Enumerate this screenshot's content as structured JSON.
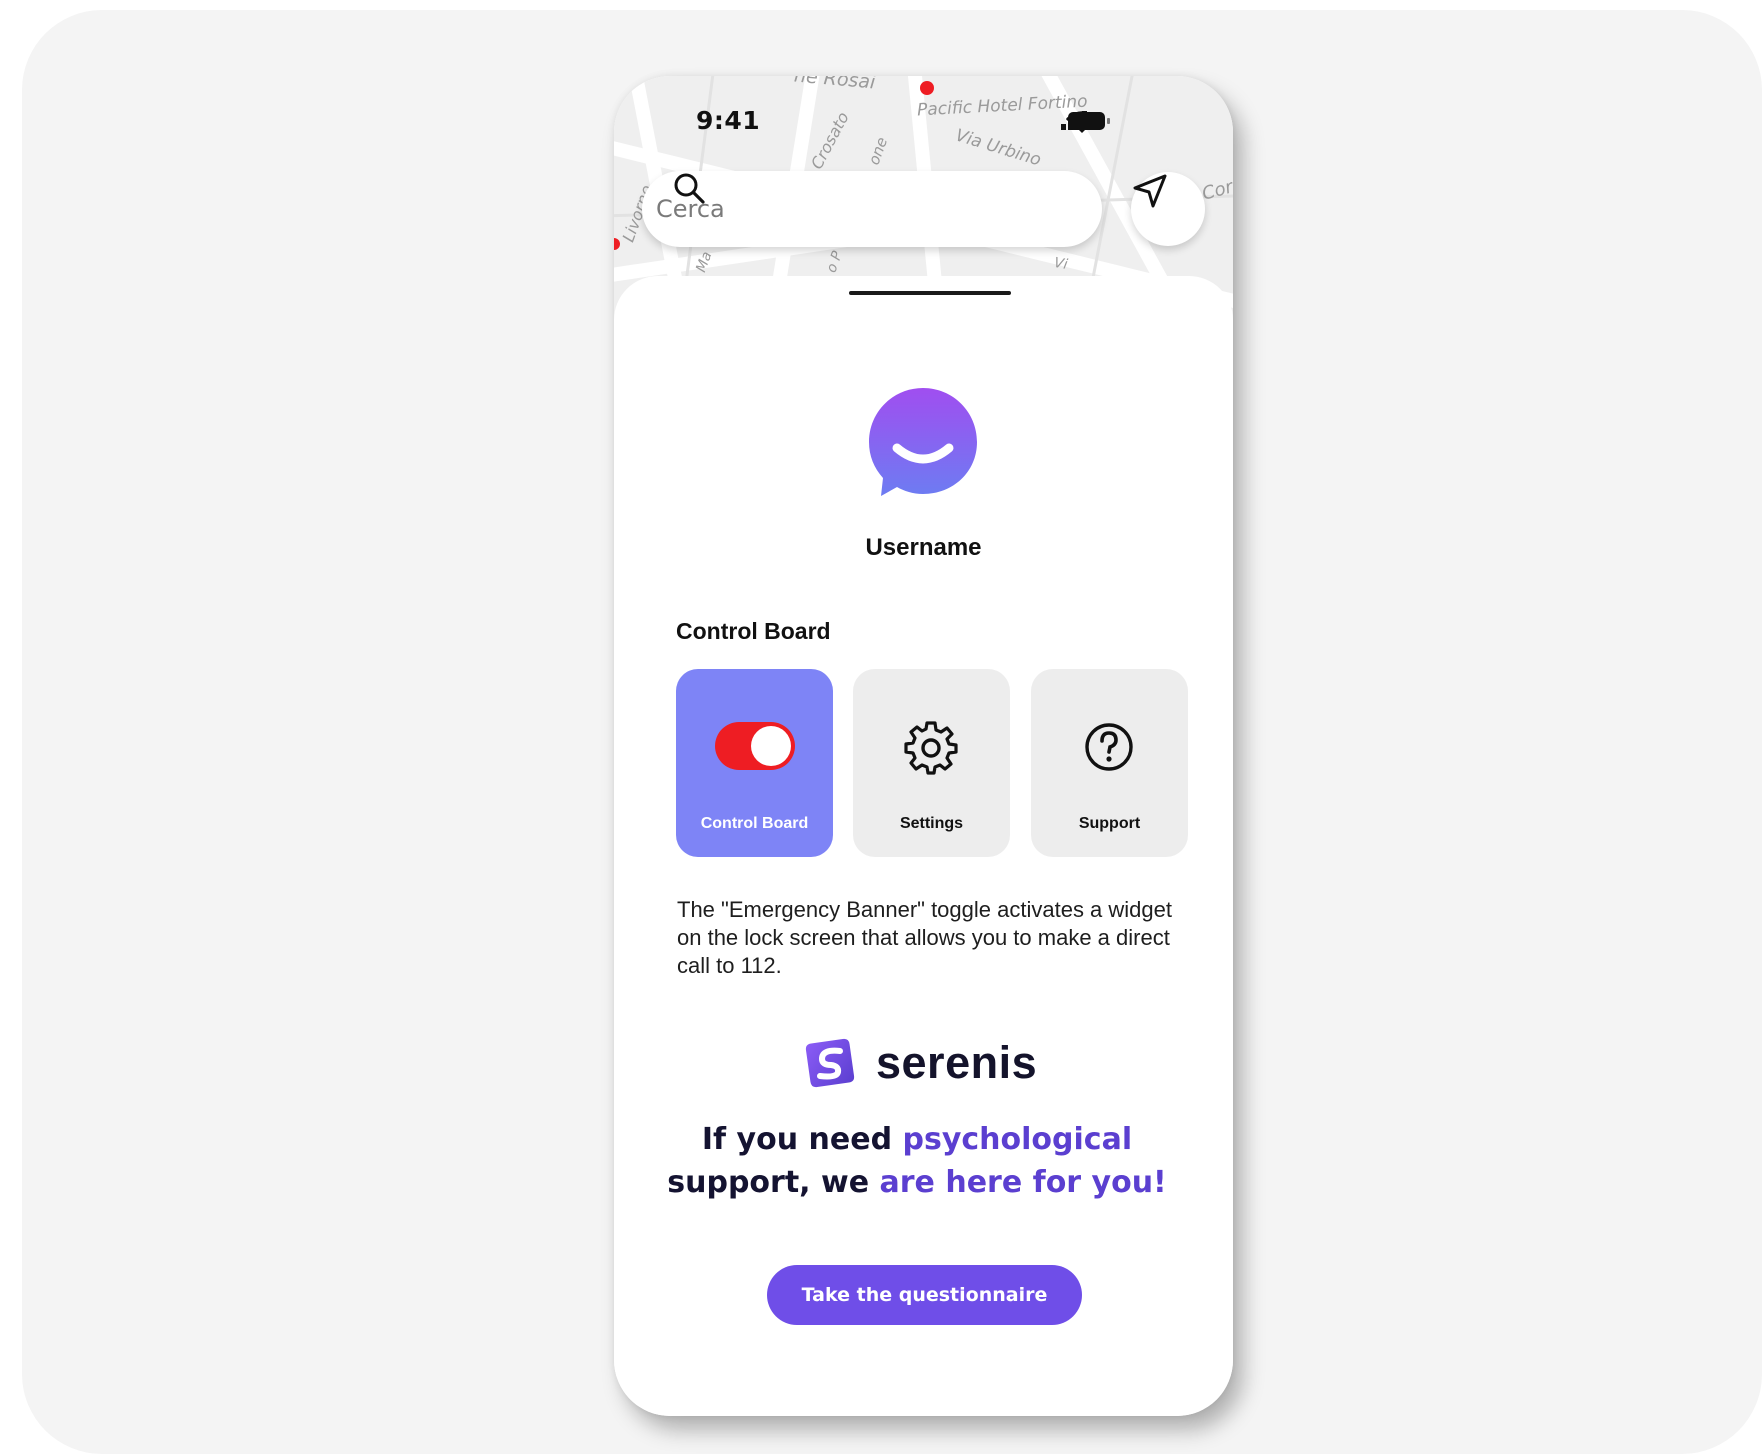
{
  "status_bar": {
    "time": "9:41"
  },
  "map": {
    "labels": [
      "ne Rosai",
      "Pacific Hotel Fortino",
      "Via Urbino",
      "Crosato",
      "Livorno",
      "one",
      "Cor",
      "Ma",
      "o P",
      "Vi"
    ]
  },
  "search": {
    "placeholder": "Cerca"
  },
  "profile": {
    "username": "Username"
  },
  "control_board": {
    "title": "Control Board",
    "tiles": [
      {
        "label": "Control Board",
        "icon": "toggle-icon",
        "active": true,
        "toggle_on": true
      },
      {
        "label": "Settings",
        "icon": "gear-icon",
        "active": false
      },
      {
        "label": "Support",
        "icon": "question-circle-icon",
        "active": false
      }
    ]
  },
  "description": "The \"Emergency Banner\" toggle activates a widget on the lock screen that allows you to make a direct call to 112.",
  "brand": {
    "name": "serenis",
    "logo": "serenis-logo"
  },
  "promo": {
    "part1": "If you need ",
    "part2": "psychological",
    "part3": "support, ",
    "part4": "we ",
    "part5": "are here for you!"
  },
  "cta": {
    "label": "Take the questionnaire"
  },
  "colors": {
    "active_tile": "#7e84f6",
    "toggle_on": "#ee1d23",
    "accent": "#5b3fd0",
    "cta": "#6f4ee8",
    "background": "#f4f4f4"
  }
}
